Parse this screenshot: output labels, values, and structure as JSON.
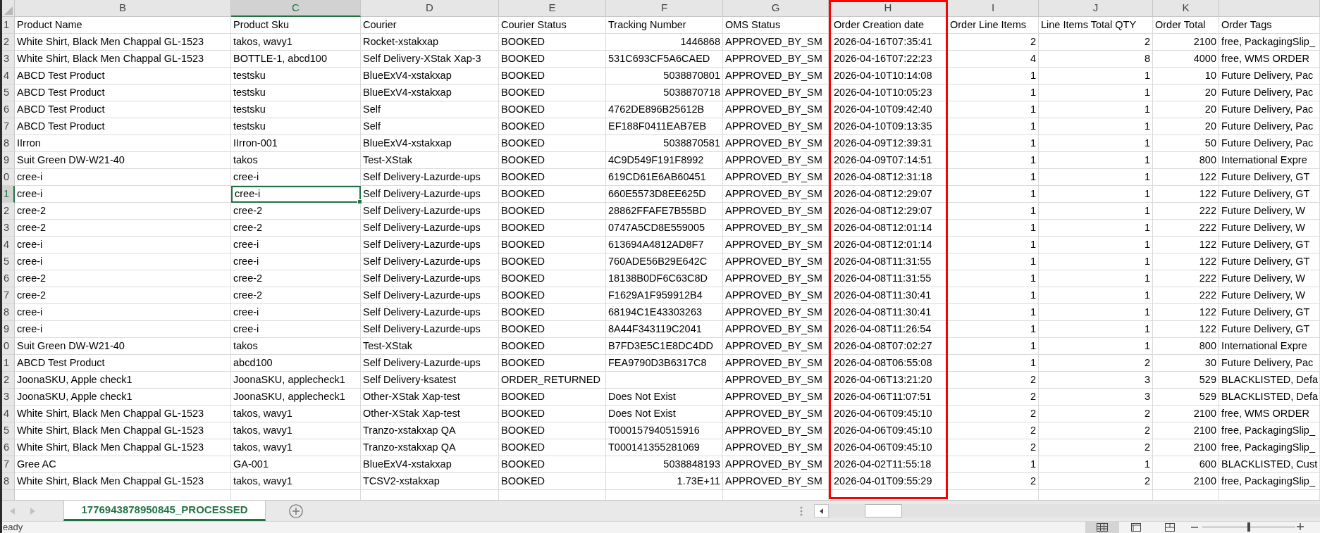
{
  "columns": [
    {
      "letter": "B",
      "selected": false,
      "highlighted": false
    },
    {
      "letter": "C",
      "selected": true,
      "highlighted": false
    },
    {
      "letter": "D",
      "selected": false,
      "highlighted": false
    },
    {
      "letter": "E",
      "selected": false,
      "highlighted": false
    },
    {
      "letter": "F",
      "selected": false,
      "highlighted": false
    },
    {
      "letter": "G",
      "selected": false,
      "highlighted": false
    },
    {
      "letter": "H",
      "selected": false,
      "highlighted": true
    },
    {
      "letter": "I",
      "selected": false,
      "highlighted": false
    },
    {
      "letter": "J",
      "selected": false,
      "highlighted": false
    },
    {
      "letter": "K",
      "selected": false,
      "highlighted": false
    },
    {
      "selected": false,
      "highlighted": false
    }
  ],
  "rows": [
    {
      "number": "1",
      "selected": false,
      "cells": [
        "Product Name",
        "Product Sku",
        "Courier",
        "Courier Status",
        "Tracking Number",
        "OMS Status",
        "Order Creation date",
        "Order Line Items",
        "Line Items Total QTY",
        "Order Total",
        "Order Tags"
      ]
    },
    {
      "number": "2",
      "selected": false,
      "cells": [
        "White Shirt, Black Men Chappal GL-1523",
        "takos, wavy1",
        "Rocket-xstakxap",
        "BOOKED",
        {
          "number": "1446868"
        },
        "APPROVED_BY_SM",
        "2026-04-16T07:35:41",
        {
          "number": "2"
        },
        {
          "number": "2"
        },
        {
          "number": "2100"
        },
        "free, PackagingSlip_"
      ]
    },
    {
      "number": "3",
      "selected": false,
      "cells": [
        "White Shirt, Black Men Chappal GL-1523",
        "BOTTLE-1, abcd100",
        "Self Delivery-XStak Xap-3",
        "BOOKED",
        "531C693CF5A6CAED",
        "APPROVED_BY_SM",
        "2026-04-16T07:22:23",
        {
          "number": "4"
        },
        {
          "number": "8"
        },
        {
          "number": "4000"
        },
        "free, WMS ORDER"
      ]
    },
    {
      "number": "4",
      "selected": false,
      "cells": [
        "ABCD Test Product",
        "testsku",
        "BlueExV4-xstakxap",
        "BOOKED",
        {
          "number": "5038870801"
        },
        "APPROVED_BY_SM",
        "2026-04-10T10:14:08",
        {
          "number": "1"
        },
        {
          "number": "1"
        },
        {
          "number": "10"
        },
        "Future Delivery, Pac"
      ]
    },
    {
      "number": "5",
      "selected": false,
      "cells": [
        "ABCD Test Product",
        "testsku",
        "BlueExV4-xstakxap",
        "BOOKED",
        {
          "number": "5038870718"
        },
        "APPROVED_BY_SM",
        "2026-04-10T10:05:23",
        {
          "number": "1"
        },
        {
          "number": "1"
        },
        {
          "number": "20"
        },
        "Future Delivery, Pac"
      ]
    },
    {
      "number": "6",
      "selected": false,
      "cells": [
        "ABCD Test Product",
        "testsku",
        "Self",
        "BOOKED",
        "4762DE896B25612B",
        "APPROVED_BY_SM",
        "2026-04-10T09:42:40",
        {
          "number": "1"
        },
        {
          "number": "1"
        },
        {
          "number": "20"
        },
        "Future Delivery, Pac"
      ]
    },
    {
      "number": "7",
      "selected": false,
      "cells": [
        "ABCD Test Product",
        "testsku",
        "Self",
        "BOOKED",
        "EF188F0411EAB7EB",
        "APPROVED_BY_SM",
        "2026-04-10T09:13:35",
        {
          "number": "1"
        },
        {
          "number": "1"
        },
        {
          "number": "20"
        },
        "Future Delivery, Pac"
      ]
    },
    {
      "number": "8",
      "selected": false,
      "cells": [
        "IIrron",
        "IIrron-001",
        "BlueExV4-xstakxap",
        "BOOKED",
        {
          "number": "5038870581"
        },
        "APPROVED_BY_SM",
        "2026-04-09T12:39:31",
        {
          "number": "1"
        },
        {
          "number": "1"
        },
        {
          "number": "50"
        },
        "Future Delivery, Pac"
      ]
    },
    {
      "number": "9",
      "selected": false,
      "cells": [
        "Suit Green DW-W21-40",
        "takos",
        "Test-XStak",
        "BOOKED",
        "4C9D549F191F8992",
        "APPROVED_BY_SM",
        "2026-04-09T07:14:51",
        {
          "number": "1"
        },
        {
          "number": "1"
        },
        {
          "number": "800"
        },
        "International Expre"
      ]
    },
    {
      "number": "0",
      "selected": false,
      "cells": [
        "cree-i",
        "cree-i",
        "Self Delivery-Lazurde-ups",
        "BOOKED",
        "619CD61E6AB60451",
        "APPROVED_BY_SM",
        "2026-04-08T12:31:18",
        {
          "number": "1"
        },
        {
          "number": "1"
        },
        {
          "number": "122"
        },
        "Future Delivery, GT"
      ]
    },
    {
      "number": "1",
      "selected": true,
      "cells": [
        "cree-i",
        "cree-i",
        "Self Delivery-Lazurde-ups",
        "BOOKED",
        "660E5573D8EE625D",
        "APPROVED_BY_SM",
        "2026-04-08T12:29:07",
        {
          "number": "1"
        },
        {
          "number": "1"
        },
        {
          "number": "122"
        },
        "Future Delivery, GT"
      ]
    },
    {
      "number": "2",
      "selected": false,
      "cells": [
        "cree-2",
        "cree-2",
        "Self Delivery-Lazurde-ups",
        "BOOKED",
        "28862FFAFE7B55BD",
        "APPROVED_BY_SM",
        "2026-04-08T12:29:07",
        {
          "number": "1"
        },
        {
          "number": "1"
        },
        {
          "number": "222"
        },
        "Future Delivery, W"
      ]
    },
    {
      "number": "3",
      "selected": false,
      "cells": [
        "cree-2",
        "cree-2",
        "Self Delivery-Lazurde-ups",
        "BOOKED",
        "0747A5CD8E559005",
        "APPROVED_BY_SM",
        "2026-04-08T12:01:14",
        {
          "number": "1"
        },
        {
          "number": "1"
        },
        {
          "number": "222"
        },
        "Future Delivery, W"
      ]
    },
    {
      "number": "4",
      "selected": false,
      "cells": [
        "cree-i",
        "cree-i",
        "Self Delivery-Lazurde-ups",
        "BOOKED",
        "613694A4812AD8F7",
        "APPROVED_BY_SM",
        "2026-04-08T12:01:14",
        {
          "number": "1"
        },
        {
          "number": "1"
        },
        {
          "number": "122"
        },
        "Future Delivery, GT"
      ]
    },
    {
      "number": "5",
      "selected": false,
      "cells": [
        "cree-i",
        "cree-i",
        "Self Delivery-Lazurde-ups",
        "BOOKED",
        "760ADE56B29E642C",
        "APPROVED_BY_SM",
        "2026-04-08T11:31:55",
        {
          "number": "1"
        },
        {
          "number": "1"
        },
        {
          "number": "122"
        },
        "Future Delivery, GT"
      ]
    },
    {
      "number": "6",
      "selected": false,
      "cells": [
        "cree-2",
        "cree-2",
        "Self Delivery-Lazurde-ups",
        "BOOKED",
        "18138B0DF6C63C8D",
        "APPROVED_BY_SM",
        "2026-04-08T11:31:55",
        {
          "number": "1"
        },
        {
          "number": "1"
        },
        {
          "number": "222"
        },
        "Future Delivery, W"
      ]
    },
    {
      "number": "7",
      "selected": false,
      "cells": [
        "cree-2",
        "cree-2",
        "Self Delivery-Lazurde-ups",
        "BOOKED",
        "F1629A1F959912B4",
        "APPROVED_BY_SM",
        "2026-04-08T11:30:41",
        {
          "number": "1"
        },
        {
          "number": "1"
        },
        {
          "number": "222"
        },
        "Future Delivery, W"
      ]
    },
    {
      "number": "8",
      "selected": false,
      "cells": [
        "cree-i",
        "cree-i",
        "Self Delivery-Lazurde-ups",
        "BOOKED",
        "68194C1E43303263",
        "APPROVED_BY_SM",
        "2026-04-08T11:30:41",
        {
          "number": "1"
        },
        {
          "number": "1"
        },
        {
          "number": "122"
        },
        "Future Delivery, GT"
      ]
    },
    {
      "number": "9",
      "selected": false,
      "cells": [
        "cree-i",
        "cree-i",
        "Self Delivery-Lazurde-ups",
        "BOOKED",
        "8A44F343119C2041",
        "APPROVED_BY_SM",
        "2026-04-08T11:26:54",
        {
          "number": "1"
        },
        {
          "number": "1"
        },
        {
          "number": "122"
        },
        "Future Delivery, GT"
      ]
    },
    {
      "number": "0",
      "selected": false,
      "cells": [
        "Suit Green DW-W21-40",
        "takos",
        "Test-XStak",
        "BOOKED",
        "B7FD3E5C1E8DC4DD",
        "APPROVED_BY_SM",
        "2026-04-08T07:02:27",
        {
          "number": "1"
        },
        {
          "number": "1"
        },
        {
          "number": "800"
        },
        "International Expre"
      ]
    },
    {
      "number": "1",
      "selected": false,
      "cells": [
        "ABCD Test Product",
        "abcd100",
        "Self Delivery-Lazurde-ups",
        "BOOKED",
        "FEA9790D3B6317C8",
        "APPROVED_BY_SM",
        "2026-04-08T06:55:08",
        {
          "number": "1"
        },
        {
          "number": "2"
        },
        {
          "number": "30"
        },
        "Future Delivery, Pac"
      ]
    },
    {
      "number": "2",
      "selected": false,
      "cells": [
        "JoonaSKU, Apple check1",
        "JoonaSKU, applecheck1",
        "Self Delivery-ksatest",
        "ORDER_RETURNED",
        null,
        "APPROVED_BY_SM",
        "2026-04-06T13:21:20",
        {
          "number": "2"
        },
        {
          "number": "3"
        },
        {
          "number": "529"
        },
        "BLACKLISTED, Defa"
      ]
    },
    {
      "number": "3",
      "selected": false,
      "cells": [
        "JoonaSKU, Apple check1",
        "JoonaSKU, applecheck1",
        "Other-XStak Xap-test",
        "BOOKED",
        "Does Not Exist",
        "APPROVED_BY_SM",
        "2026-04-06T11:07:51",
        {
          "number": "2"
        },
        {
          "number": "3"
        },
        {
          "number": "529"
        },
        "BLACKLISTED, Defa"
      ]
    },
    {
      "number": "4",
      "selected": false,
      "cells": [
        "White Shirt, Black Men Chappal GL-1523",
        "takos, wavy1",
        "Other-XStak Xap-test",
        "BOOKED",
        "Does Not Exist",
        "APPROVED_BY_SM",
        "2026-04-06T09:45:10",
        {
          "number": "2"
        },
        {
          "number": "2"
        },
        {
          "number": "2100"
        },
        "free, WMS ORDER"
      ]
    },
    {
      "number": "5",
      "selected": false,
      "cells": [
        "White Shirt, Black Men Chappal GL-1523",
        "takos, wavy1",
        "Tranzo-xstakxap QA",
        "BOOKED",
        "T000157940515916",
        "APPROVED_BY_SM",
        "2026-04-06T09:45:10",
        {
          "number": "2"
        },
        {
          "number": "2"
        },
        {
          "number": "2100"
        },
        "free, PackagingSlip_"
      ]
    },
    {
      "number": "6",
      "selected": false,
      "cells": [
        "White Shirt, Black Men Chappal GL-1523",
        "takos, wavy1",
        "Tranzo-xstakxap QA",
        "BOOKED",
        "T000141355281069",
        "APPROVED_BY_SM",
        "2026-04-06T09:45:10",
        {
          "number": "2"
        },
        {
          "number": "2"
        },
        {
          "number": "2100"
        },
        "free, PackagingSlip_"
      ]
    },
    {
      "number": "7",
      "selected": false,
      "cells": [
        "Gree AC",
        "GA-001",
        "BlueExV4-xstakxap",
        "BOOKED",
        {
          "number": "5038848193"
        },
        "APPROVED_BY_SM",
        "2026-04-02T11:55:18",
        {
          "number": "1"
        },
        {
          "number": "1"
        },
        {
          "number": "600"
        },
        "BLACKLISTED, Cust"
      ]
    },
    {
      "number": "8",
      "selected": false,
      "cells": [
        "White Shirt, Black Men Chappal GL-1523",
        "takos, wavy1",
        "TCSV2-xstakxap",
        "BOOKED",
        {
          "number": "1.73E+11"
        },
        "APPROVED_BY_SM",
        "2026-04-01T09:55:29",
        {
          "number": "2"
        },
        {
          "number": "2"
        },
        {
          "number": "2100"
        },
        "free, PackagingSlip_"
      ]
    }
  ],
  "sheet_tabs": [
    {
      "label": "1776943878950845_PROCESSED",
      "selected": true
    }
  ],
  "status_bar": {
    "text": "eady",
    "views": [
      {
        "kind": "normal",
        "selected": true
      },
      {
        "kind": "page_layout",
        "selected": false
      },
      {
        "kind": "page_break",
        "selected": false
      }
    ],
    "zoom": {
      "level": 0.5
    }
  }
}
